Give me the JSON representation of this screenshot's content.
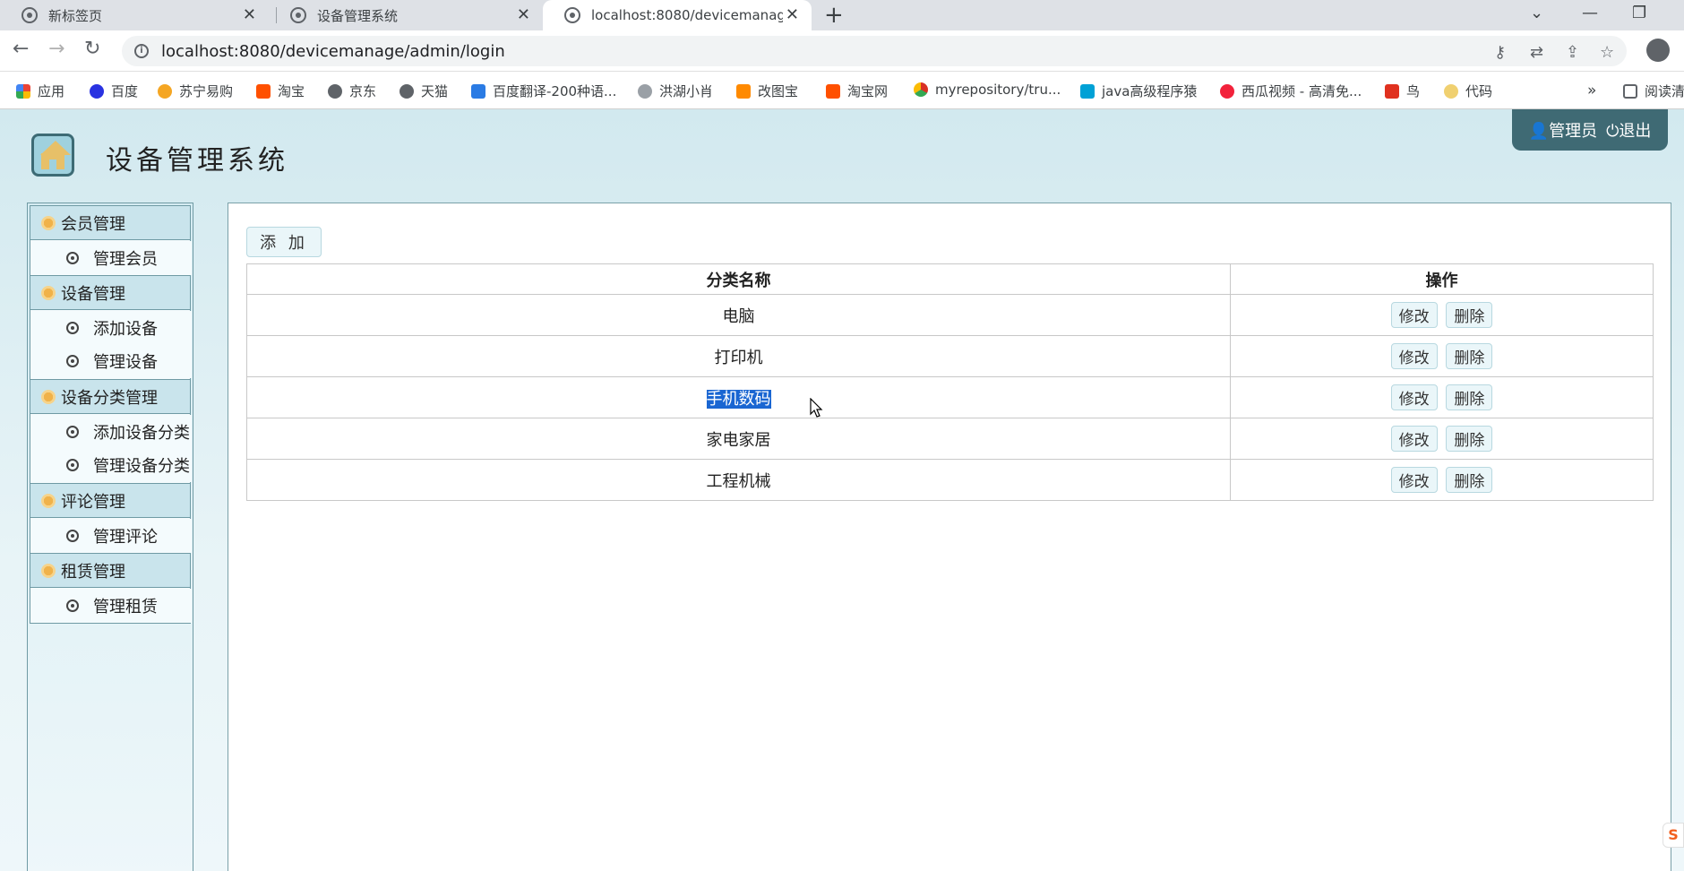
{
  "browser": {
    "tabs": [
      {
        "title": "新标签页",
        "active": false
      },
      {
        "title": "设备管理系统",
        "active": false
      },
      {
        "title": "localhost:8080/devicemanage/",
        "active": true
      }
    ],
    "url": "localhost:8080/devicemanage/admin/login",
    "bookmarks": [
      {
        "label": "应用",
        "color": "#ea4335"
      },
      {
        "label": "百度",
        "color": "#2932e1"
      },
      {
        "label": "苏宁易购",
        "color": "#f5a623"
      },
      {
        "label": "淘宝",
        "color": "#ff5000"
      },
      {
        "label": "京东",
        "color": "#5f6368"
      },
      {
        "label": "天猫",
        "color": "#5f6368"
      },
      {
        "label": "百度翻译-200种语...",
        "color": "#2a7be4"
      },
      {
        "label": "洪湖小肖",
        "color": "#7a7a7a"
      },
      {
        "label": "改图宝",
        "color": "#ff8a00"
      },
      {
        "label": "淘宝网",
        "color": "#ff5000"
      },
      {
        "label": "myrepository/tru...",
        "color": "#d93025"
      },
      {
        "label": "java高级程序猿",
        "color": "#00a1d6"
      },
      {
        "label": "西瓜视频 - 高清免...",
        "color": "#f2223b"
      },
      {
        "label": "鸟",
        "color": "#e0311f"
      },
      {
        "label": "代码",
        "color": "#f0d070"
      }
    ],
    "more": "»",
    "reading_list": "阅读清"
  },
  "header": {
    "site_title": "设备管理系统",
    "user_label": "管理员",
    "logout_label": "退出"
  },
  "sidebar": {
    "groups": [
      {
        "label": "会员管理",
        "items": [
          "管理会员"
        ]
      },
      {
        "label": "设备管理",
        "items": [
          "添加设备",
          "管理设备"
        ]
      },
      {
        "label": "设备分类管理",
        "items": [
          "添加设备分类",
          "管理设备分类"
        ]
      },
      {
        "label": "评论管理",
        "items": [
          "管理评论"
        ]
      },
      {
        "label": "租赁管理",
        "items": [
          "管理租赁"
        ]
      }
    ]
  },
  "main": {
    "add_label": "添 加",
    "columns": [
      "分类名称",
      "操作"
    ],
    "edit_label": "修改",
    "delete_label": "删除",
    "rows": [
      {
        "name": "电脑"
      },
      {
        "name": "打印机"
      },
      {
        "name": "手机数码",
        "selected": true
      },
      {
        "name": "家电家居"
      },
      {
        "name": "工程机械"
      }
    ]
  }
}
